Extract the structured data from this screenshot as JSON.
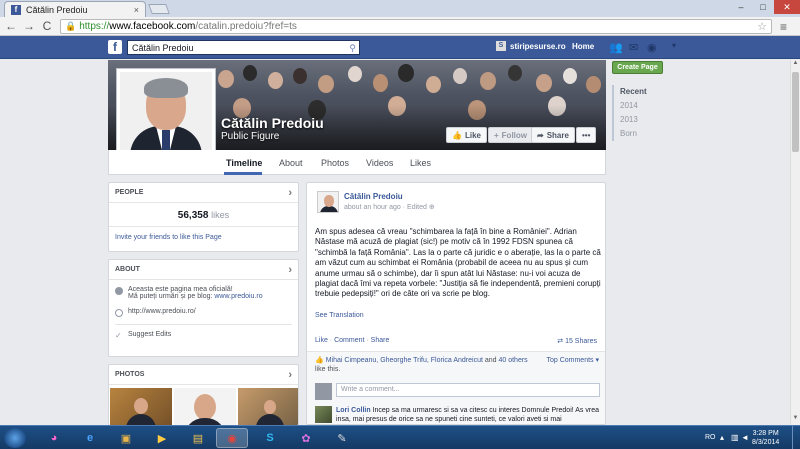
{
  "browser": {
    "tab_title": "Cătălin Predoiu",
    "tab_close": "×",
    "url_scheme": "https://",
    "url_host": "www.facebook.com",
    "url_path": "/catalin.predoiu?fref=ts",
    "back": "←",
    "forward": "→",
    "reload": "C",
    "star": "☆",
    "menu": "≡",
    "win_min": "–",
    "win_max": "□",
    "win_close": "✕"
  },
  "fbbar": {
    "logo": "f",
    "search_value": "Cătălin Predoiu",
    "site_label": "stiripesurse.ro",
    "site_icon": "S",
    "home": "Home"
  },
  "profile": {
    "name": "Cătălin Predoiu",
    "category": "Public Figure",
    "like_button": "Like",
    "follow_button": "Follow",
    "share_button": "Share",
    "more_button": "•••"
  },
  "tabs": [
    "Timeline",
    "About",
    "Photos",
    "Videos",
    "Likes"
  ],
  "right_rail": {
    "create_page": "Create Page",
    "years": [
      "Recent",
      "2014",
      "2013",
      "Born"
    ]
  },
  "people": {
    "title": "PEOPLE",
    "likes_count": "56,358",
    "likes_word": "likes",
    "invite": "Invite your friends to like this Page"
  },
  "about": {
    "title": "ABOUT",
    "line1": "Aceasta este pagina mea oficială!",
    "line2a": "Mă puteți urmări și pe blog: ",
    "line2b": "www.predoiu.ro",
    "website": "http://www.predoiu.ro/",
    "suggest": "Suggest Edits"
  },
  "photos": {
    "title": "PHOTOS"
  },
  "post": {
    "author": "Cătălin Predoiu",
    "time": "about an hour ago · Edited",
    "text": "Am spus adesea că vreau \"schimbarea la față în bine a României\". Adrian Năstase mă acuză de plagiat (sic!) pe motiv că în 1992 FDSN spunea că \"schimbă la față România\". Las la o parte că juridic e o aberație, las la o parte că am văzut cum au schimbat ei România (probabil de aceea nu au spus și cum anume urmau să o schimbe), dar îi spun atât lui Năstase: nu-i voi acuza de plagiat dacă îmi va repeta vorbele: \"Justiția să fie independentă, premieni corupți trebuie pedepsiți!\" ori de câte ori va scrie pe blog.",
    "see_translation": "See Translation",
    "like": "Like",
    "comment": "Comment",
    "share": "Share",
    "shares": "15 Shares",
    "likers_names": "Mihai Cimpeanu, Gheorghe Trifu, Florica Andreicut",
    "likers_and": " and ",
    "likers_others": "40 others",
    "likers_tail": " like this.",
    "top_comments": "Top Comments ▾",
    "comment_placeholder": "Write a comment...",
    "comment1_author": "Lori Collin",
    "comment1_text": " Incep sa ma urmaresc si sa va citesc cu interes Domnule Predoi! As vrea insa, mai presus de orice sa ne spuneti cine sunteti, ce valori aveti si mai"
  },
  "taskbar": {
    "lang": "RO",
    "time": "3:28 PM",
    "date": "8/3/2014"
  }
}
